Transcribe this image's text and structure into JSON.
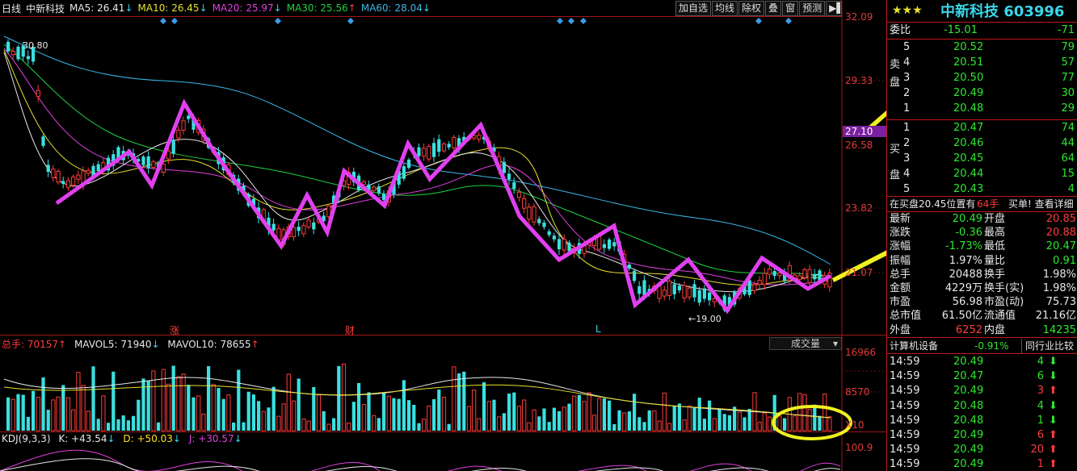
{
  "header": {
    "period": "日线",
    "stock_name": "中新科技",
    "ma5": "MA5: 26.41",
    "ma10": "MA10: 26.45",
    "ma20": "MA20: 25.97",
    "ma30": "MA30: 25.56",
    "ma60": "MA60: 28.04",
    "buttons": [
      "加自选",
      "均线",
      "除权",
      "叠",
      "窗",
      "预测"
    ],
    "colors": {
      "ma5": "#e8e8e8",
      "ma10": "#e8e030",
      "ma20": "#e040e0",
      "ma30": "#20d040",
      "ma60": "#3ab8e8"
    }
  },
  "price_axis": [
    "32.09",
    "29.33",
    "27.10",
    "26.58",
    "23.82",
    "21.07"
  ],
  "chart_labels": {
    "high": "30.80",
    "low": "19.00",
    "event_1": "涨",
    "event_2": "财",
    "event_3": "L"
  },
  "volume": {
    "legend_total": "总手: 70157",
    "mavol5": "MAVOL5: 71940",
    "mavol10": "MAVOL10: 78655",
    "selector": "成交量",
    "axis": [
      "16966",
      "8570",
      "X10"
    ]
  },
  "kdj": {
    "legend": "KDJ(9,3,3)",
    "k": "K: +43.54",
    "d": "D: +50.03",
    "j": "J: +30.57",
    "axis": "100.9"
  },
  "quote": {
    "stars": "★★★",
    "title": "中新科技 603996",
    "weibi_label": "委比",
    "weibi_value": "-15.01",
    "weibi_diff": "-71",
    "sell_label": "卖盘",
    "buy_label": "买盘",
    "sells": [
      {
        "level": "5",
        "price": "20.52",
        "vol": "79"
      },
      {
        "level": "4",
        "price": "20.51",
        "vol": "57"
      },
      {
        "level": "3",
        "price": "20.50",
        "vol": "77"
      },
      {
        "level": "2",
        "price": "20.49",
        "vol": "30"
      },
      {
        "level": "1",
        "price": "20.48",
        "vol": "29"
      }
    ],
    "buys": [
      {
        "level": "1",
        "price": "20.47",
        "vol": "74"
      },
      {
        "level": "2",
        "price": "20.46",
        "vol": "44"
      },
      {
        "level": "3",
        "price": "20.45",
        "vol": "64"
      },
      {
        "level": "4",
        "price": "20.44",
        "vol": "15"
      },
      {
        "level": "5",
        "price": "20.43",
        "vol": "4"
      }
    ],
    "notice": "在买盘20.45位置有",
    "notice_vol": "64手",
    "notice_action": "买单! 查看详细",
    "stats": [
      {
        "l1": "最新",
        "v1": "20.49",
        "l2": "开盘",
        "v2": "20.85"
      },
      {
        "l1": "涨跌",
        "v1": "-0.36",
        "l2": "最高",
        "v2": "20.88"
      },
      {
        "l1": "涨幅",
        "v1": "-1.73%",
        "l2": "最低",
        "v2": "20.47"
      },
      {
        "l1": "振幅",
        "v1": "1.97%",
        "l2": "量比",
        "v2": "0.91"
      },
      {
        "l1": "总手",
        "v1": "20488",
        "l2": "换手",
        "v2": "1.98%"
      },
      {
        "l1": "金额",
        "v1": "4229万",
        "l2": "换手(实)",
        "v2": "1.98%"
      },
      {
        "l1": "市盈",
        "v1": "56.98",
        "l2": "市盈(动)",
        "v2": "75.73"
      },
      {
        "l1": "总市值",
        "v1": "61.50亿",
        "l2": "流通值",
        "v2": "21.16亿"
      },
      {
        "l1": "外盘",
        "v1": "6252",
        "l2": "内盘",
        "v2": "14235"
      }
    ],
    "industry": "计算机设备",
    "industry_change": "-0.91%",
    "industry_compare": "同行业比较",
    "ticks": [
      {
        "time": "14:59",
        "price": "20.49",
        "vol": "4",
        "dir": "down"
      },
      {
        "time": "14:59",
        "price": "20.47",
        "vol": "6",
        "dir": "down"
      },
      {
        "time": "14:59",
        "price": "20.49",
        "vol": "3",
        "dir": "up"
      },
      {
        "time": "14:59",
        "price": "20.48",
        "vol": "4",
        "dir": "down"
      },
      {
        "time": "14:59",
        "price": "20.48",
        "vol": "1",
        "dir": "down"
      },
      {
        "time": "14:59",
        "price": "20.49",
        "vol": "6",
        "dir": "up"
      },
      {
        "time": "14:59",
        "price": "20.49",
        "vol": "20",
        "dir": "up"
      },
      {
        "time": "14:59",
        "price": "20.49",
        "vol": "1",
        "dir": "up"
      }
    ]
  }
}
